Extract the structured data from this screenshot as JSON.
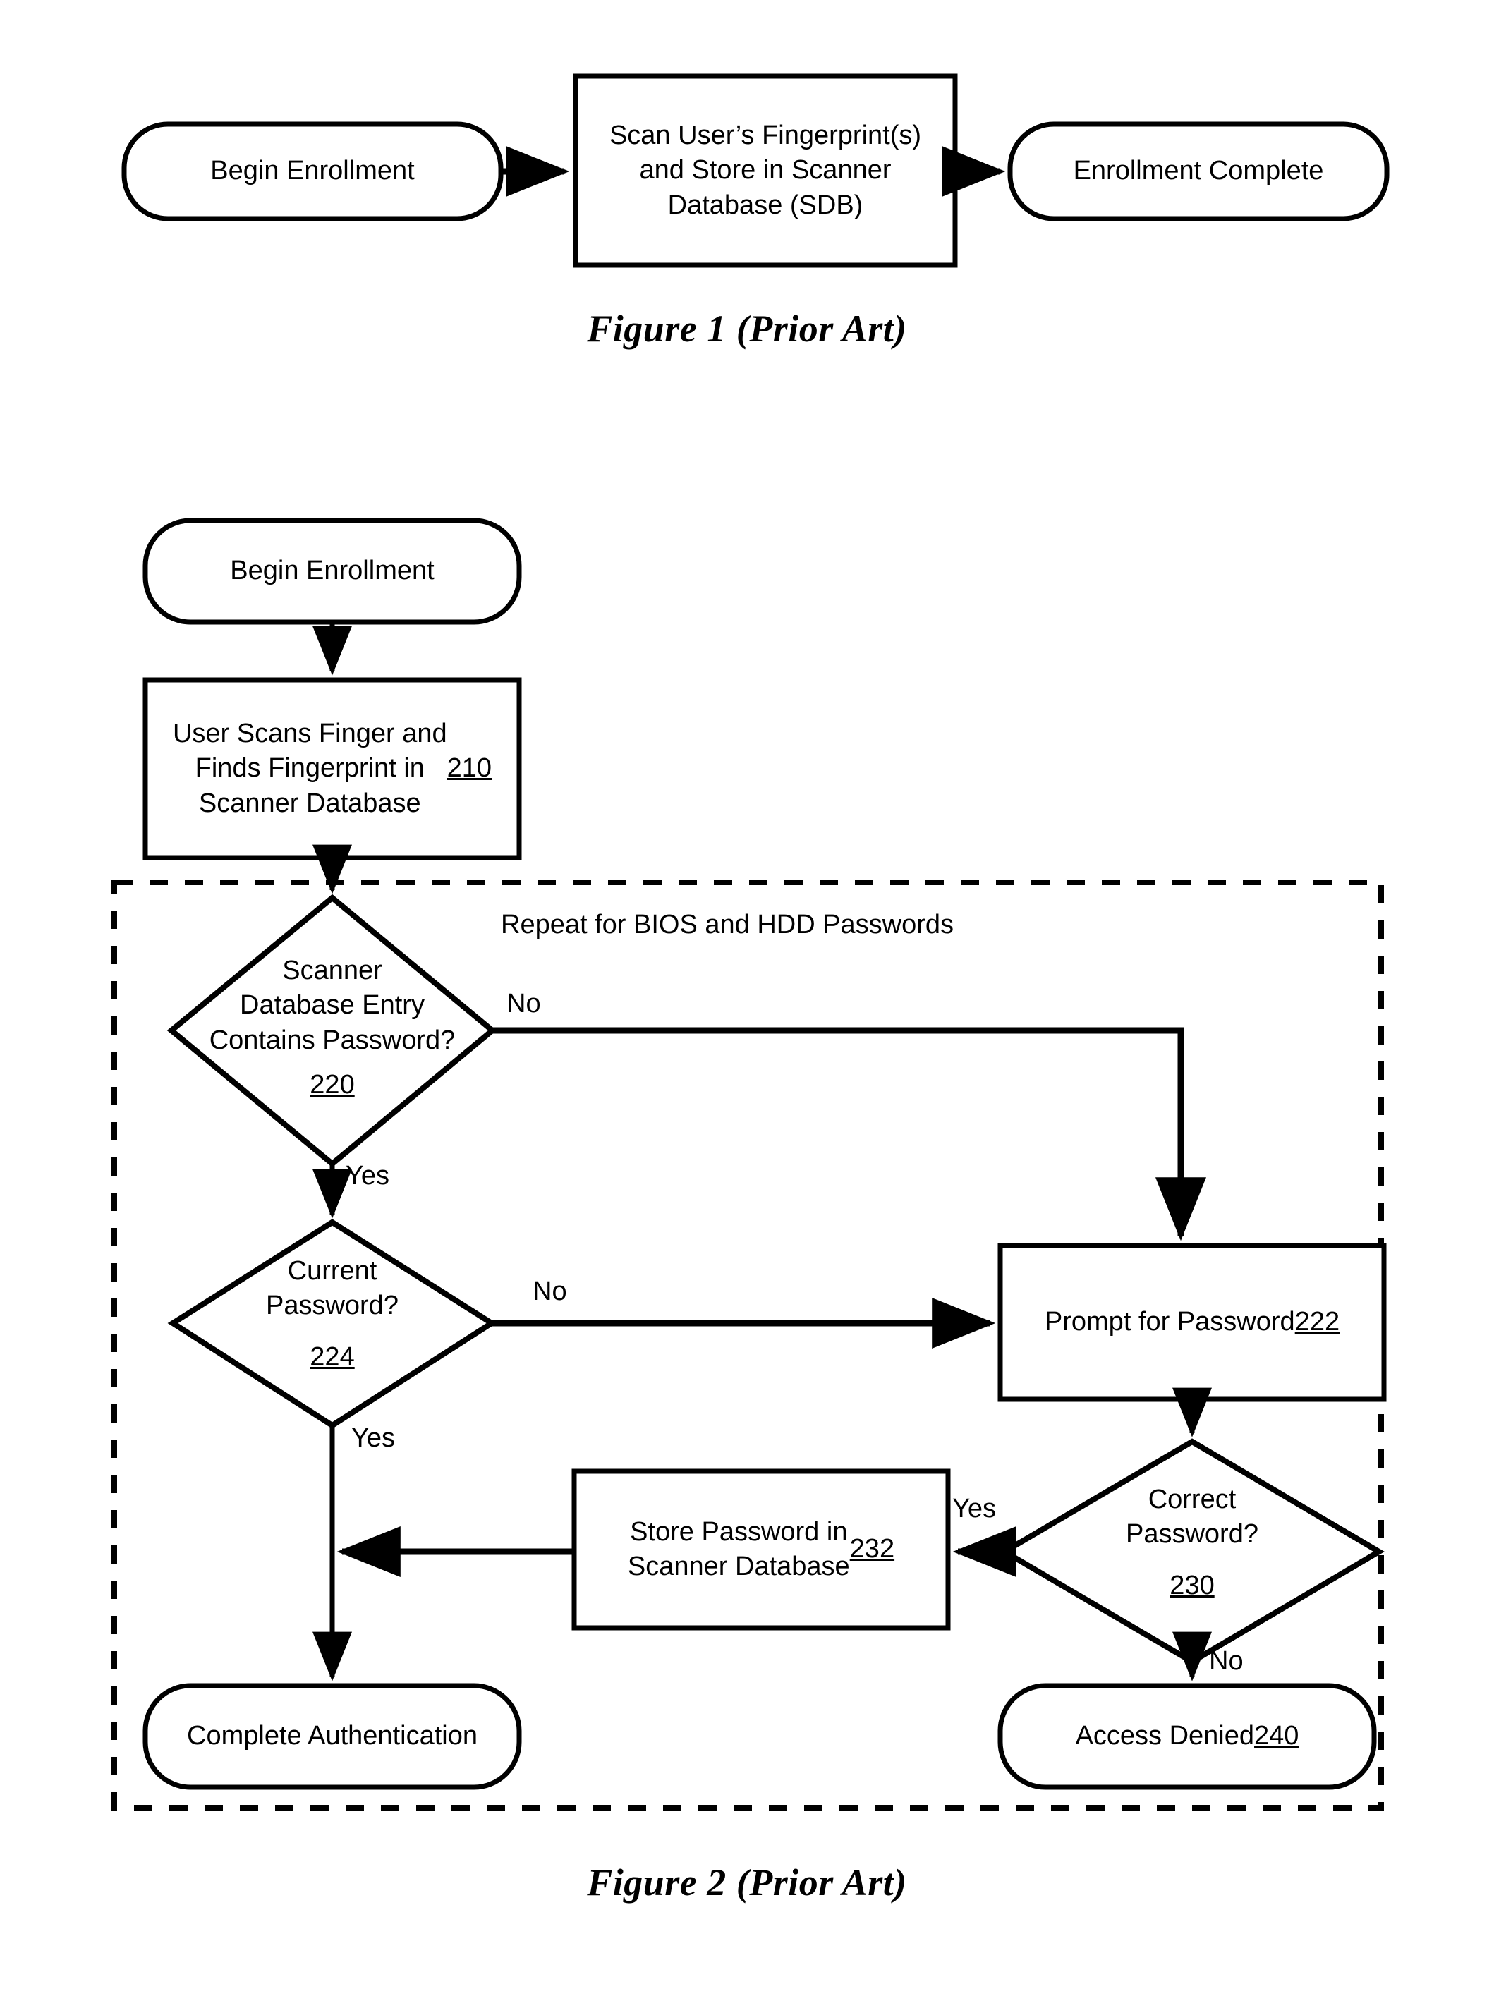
{
  "document": {
    "type": "patent-flowchart-sheet",
    "background_color": "#ffffff",
    "line_color": "#000000"
  },
  "figure1": {
    "caption": "Figure 1 (Prior Art)",
    "nodes": {
      "begin": {
        "label": "Begin Enrollment",
        "shape": "rounded-terminator"
      },
      "scan": {
        "label": "Scan User’s Fingerprint(s)\nand Store in Scanner\nDatabase (SDB)",
        "shape": "process-rectangle"
      },
      "complete": {
        "label": "Enrollment Complete",
        "shape": "rounded-terminator"
      }
    },
    "edges": [
      {
        "from": "begin",
        "to": "scan",
        "label": ""
      },
      {
        "from": "scan",
        "to": "complete",
        "label": ""
      }
    ]
  },
  "figure2": {
    "caption": "Figure 2 (Prior Art)",
    "group_label": "Repeat for BIOS and HDD Passwords",
    "nodes": {
      "begin": {
        "label": "Begin Enrollment",
        "shape": "rounded-terminator"
      },
      "scan_finger": {
        "label": "User Scans Finger and\nFinds Fingerprint in\nScanner Database ",
        "ref": "210",
        "shape": "process-rectangle"
      },
      "entry_contains": {
        "label": "Scanner\nDatabase Entry\nContains Password?",
        "ref": "220",
        "shape": "decision-diamond"
      },
      "current_password": {
        "label": "Current\nPassword?",
        "ref": "224",
        "shape": "decision-diamond"
      },
      "prompt_password": {
        "label": "Prompt for Password ",
        "ref": "222",
        "shape": "process-rectangle"
      },
      "correct_password": {
        "label": "Correct\nPassword?",
        "ref": "230",
        "shape": "decision-diamond"
      },
      "store_password": {
        "label": "Store Password in\nScanner Database ",
        "ref": "232",
        "shape": "process-rectangle"
      },
      "complete_auth": {
        "label": "Complete Authentication",
        "shape": "rounded-terminator"
      },
      "access_denied": {
        "label": "Access Denied  ",
        "ref": "240",
        "shape": "rounded-terminator"
      }
    },
    "edge_labels": {
      "entry_no": "No",
      "entry_yes": "Yes",
      "current_no": "No",
      "current_yes": "Yes",
      "correct_yes": "Yes",
      "correct_no": "No"
    }
  }
}
